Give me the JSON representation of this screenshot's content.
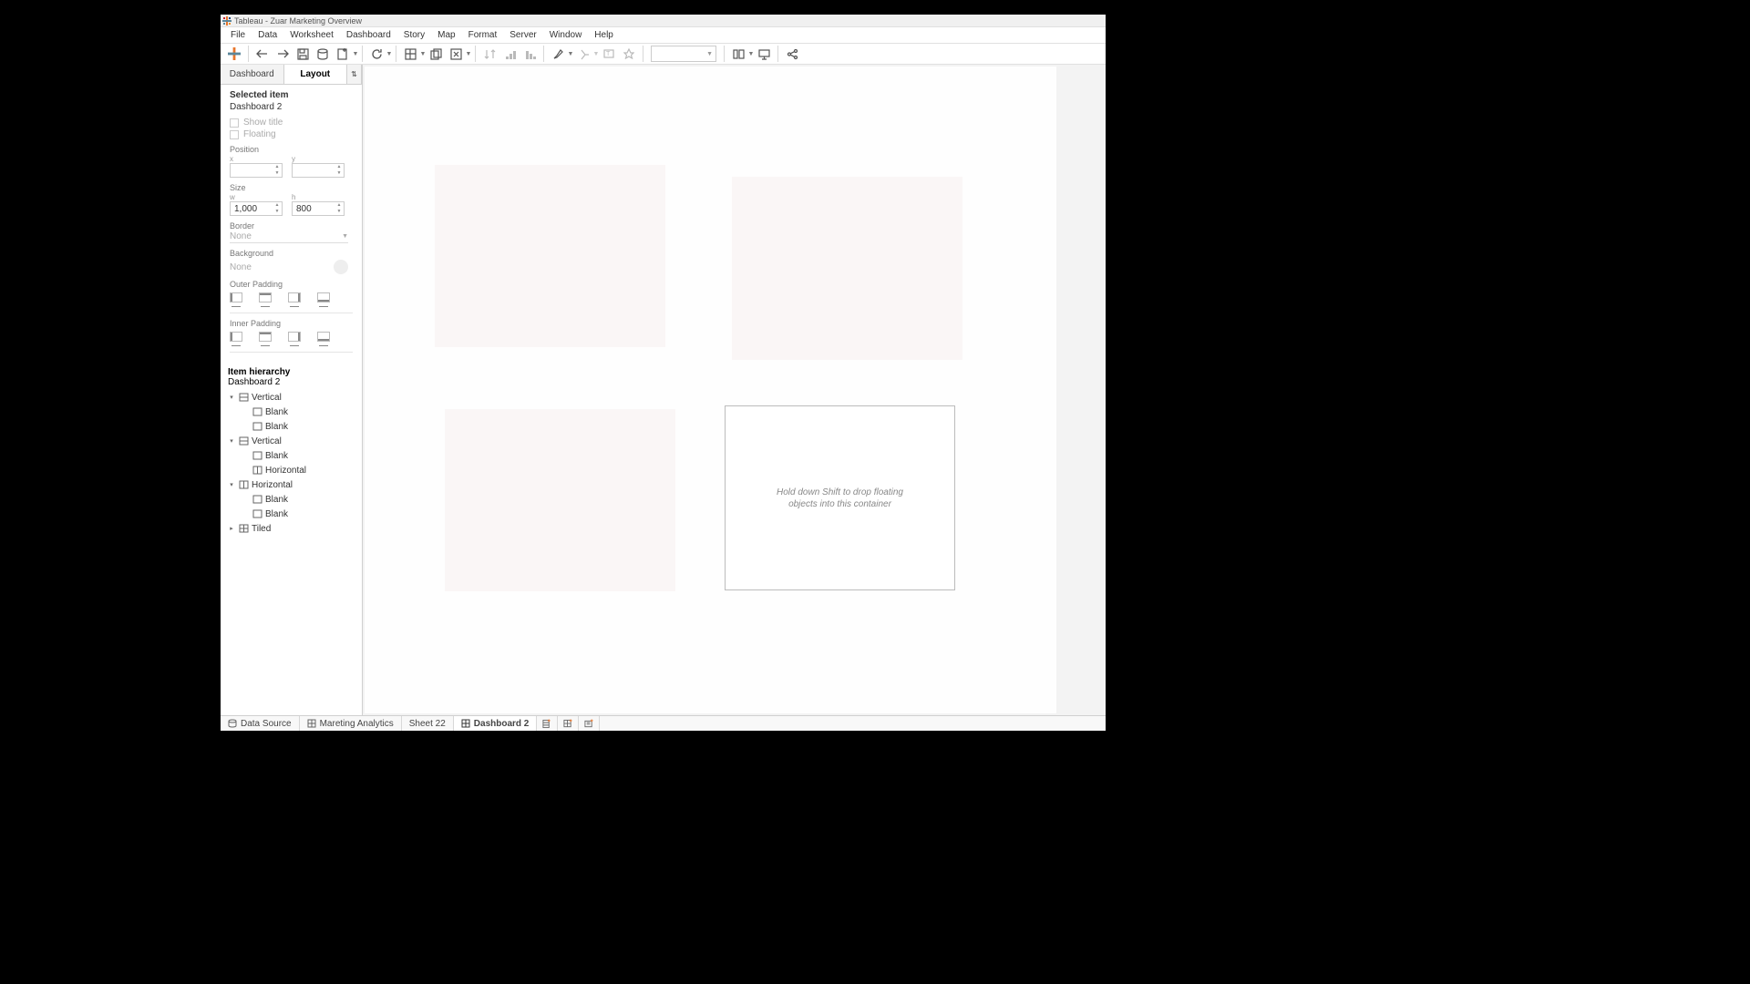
{
  "title": "Tableau - Zuar Marketing Overview",
  "menu": [
    "File",
    "Data",
    "Worksheet",
    "Dashboard",
    "Story",
    "Map",
    "Format",
    "Server",
    "Window",
    "Help"
  ],
  "pane_tabs": {
    "dashboard": "Dashboard",
    "layout": "Layout",
    "util": "⇅"
  },
  "selected": {
    "hdr": "Selected item",
    "name": "Dashboard 2",
    "show_title": "Show title",
    "floating": "Floating"
  },
  "position": {
    "label": "Position",
    "x": "x",
    "y": "y",
    "xv": "",
    "yv": ""
  },
  "size": {
    "label": "Size",
    "w": "w",
    "h": "h",
    "wv": "1,000",
    "hv": "800"
  },
  "border": {
    "label": "Border",
    "value": "None"
  },
  "background": {
    "label": "Background",
    "value": "None"
  },
  "outer_padding": {
    "label": "Outer Padding"
  },
  "inner_padding": {
    "label": "Inner Padding"
  },
  "hierarchy": {
    "hdr": "Item hierarchy",
    "root": "Dashboard 2",
    "items": [
      {
        "tw": "▾",
        "type": "vert",
        "label": "Vertical",
        "indent": 0
      },
      {
        "tw": "",
        "type": "blank",
        "label": "Blank",
        "indent": 1
      },
      {
        "tw": "",
        "type": "blank",
        "label": "Blank",
        "indent": 1
      },
      {
        "tw": "▾",
        "type": "vert",
        "label": "Vertical",
        "indent": 0
      },
      {
        "tw": "",
        "type": "blank",
        "label": "Blank",
        "indent": 1
      },
      {
        "tw": "",
        "type": "horiz",
        "label": "Horizontal",
        "indent": 1
      },
      {
        "tw": "▾",
        "type": "horiz",
        "label": "Horizontal",
        "indent": 0
      },
      {
        "tw": "",
        "type": "blank",
        "label": "Blank",
        "indent": 1
      },
      {
        "tw": "",
        "type": "blank",
        "label": "Blank",
        "indent": 1
      },
      {
        "tw": "▸",
        "type": "tiled",
        "label": "Tiled",
        "indent": 0
      }
    ]
  },
  "canvas_hint": "Hold down Shift to drop floating\nobjects into this container",
  "bottom": {
    "datasource": "Data Source",
    "tab1": "Mareting Analytics",
    "tab2": "Sheet 22",
    "tab3": "Dashboard 2"
  }
}
